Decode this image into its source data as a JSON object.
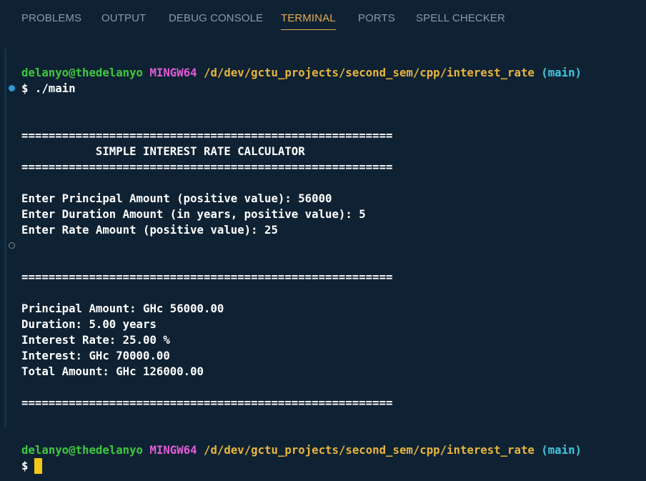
{
  "panel": {
    "tabs": [
      {
        "label": "PROBLEMS"
      },
      {
        "label": "OUTPUT"
      },
      {
        "label": "DEBUG CONSOLE"
      },
      {
        "label": "TERMINAL"
      },
      {
        "label": "PORTS"
      },
      {
        "label": "SPELL CHECKER"
      }
    ],
    "active_tab": "TERMINAL"
  },
  "terminal": {
    "prompt1": {
      "user": "delanyo@thedelanyo",
      "system": "MINGW64",
      "path": "/d/dev/gctu_projects/second_sem/cpp/interest_rate",
      "branch": "(main)"
    },
    "command": "$ ./main",
    "separator": "=======================================================",
    "header_title": "           SIMPLE INTEREST RATE CALCULATOR",
    "input_lines": [
      "Enter Principal Amount (positive value): 56000",
      "Enter Duration Amount (in years, positive value): 5",
      "Enter Rate Amount (positive value): 25"
    ],
    "result_lines": [
      "Principal Amount: GHc 56000.00",
      "Duration: 5.00 years",
      "Interest Rate: 25.00 %",
      "Interest: GHc 70000.00",
      "Total Amount: GHc 126000.00"
    ],
    "prompt2": {
      "user": "delanyo@thedelanyo",
      "system": "MINGW64",
      "path": "/d/dev/gctu_projects/second_sem/cpp/interest_rate",
      "branch": "(main)"
    },
    "final_prompt": "$"
  },
  "colors": {
    "background": "#0f2233",
    "tab_inactive": "#8a99a8",
    "tab_active": "#e8ab53",
    "user": "#3fc83f",
    "system": "#e35bd8",
    "path": "#e8b43c",
    "branch": "#40c8e0",
    "text": "#ffffff",
    "cursor": "#f5c518"
  }
}
